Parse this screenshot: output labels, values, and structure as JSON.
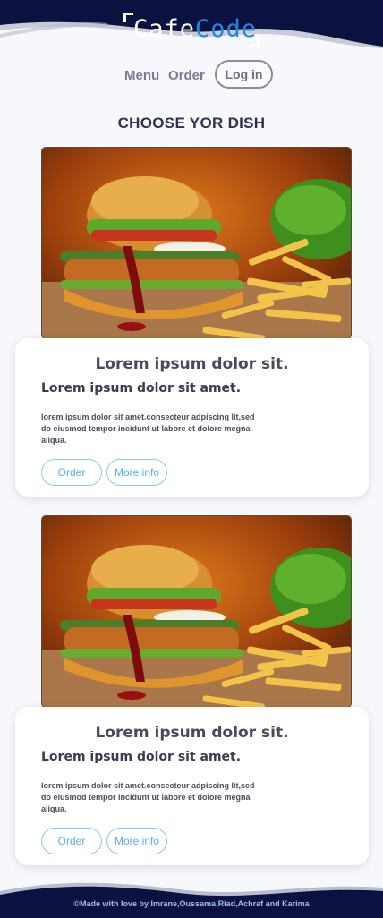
{
  "brand": {
    "part1": "Cafe",
    "part2": "Code"
  },
  "nav": {
    "menu": "Menu",
    "order": "Order",
    "login": "Log in"
  },
  "page_title": "CHOOSE YOR DISH",
  "cards": [
    {
      "title": "Lorem ipsum dolor sit.",
      "subtitle": "Lorem ipsum dolor sit amet.",
      "description": "lorem ipsum dolor sit amet.consecteur adpiscing lit,sed do eiusmod tempor incidunt ut labore et dolore megna aliqua.",
      "order_label": "Order",
      "info_label": "More info"
    },
    {
      "title": "Lorem ipsum dolor sit.",
      "subtitle": "Lorem ipsum dolor sit amet.",
      "description": "lorem ipsum dolor sit amet.consecteur adpiscing lit,sed do eiusmod tempor incidunt ut labore et dolore megna aliqua.",
      "order_label": "Order",
      "info_label": "More info"
    }
  ],
  "footer": {
    "credit": "©Made with love by  Imrane,Oussama,Riad,Achraf and Karima"
  },
  "colors": {
    "navy": "#0b1240",
    "accent": "#1e88e5",
    "button_border": "#8cc8f0"
  },
  "icons": [
    "burger-fries-image"
  ]
}
